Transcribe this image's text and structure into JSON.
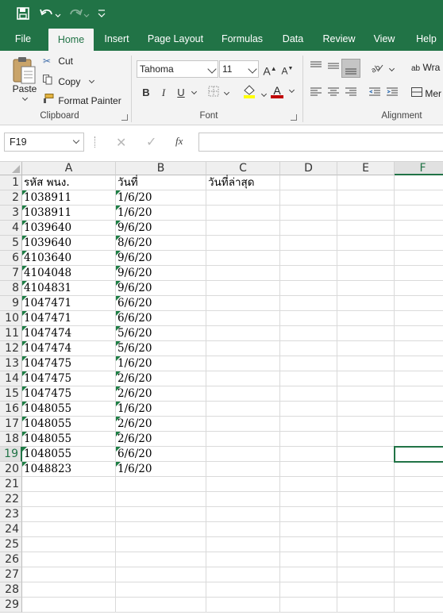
{
  "ribbon_tabs": [
    "File",
    "Home",
    "Insert",
    "Page Layout",
    "Formulas",
    "Data",
    "Review",
    "View",
    "Help"
  ],
  "active_tab": "Home",
  "clipboard": {
    "paste_label": "Paste",
    "cut_label": "Cut",
    "copy_label": "Copy",
    "format_painter_label": "Format Painter",
    "group_label": "Clipboard"
  },
  "font": {
    "family": "Tahoma",
    "size": "11",
    "grow_label": "A",
    "shrink_label": "A",
    "bold": "B",
    "italic": "I",
    "underline": "U",
    "font_color_label": "A",
    "group_label": "Font",
    "fill_color": "#FFFF00",
    "font_color": "#C00000"
  },
  "alignment": {
    "wrap_label": "Wra",
    "merge_label": "Mer",
    "group_label": "Alignment"
  },
  "formula_bar": {
    "name_box": "F19",
    "fx_label": "fx",
    "formula_value": ""
  },
  "columns": [
    "A",
    "B",
    "C",
    "D",
    "E",
    "F"
  ],
  "selected_column": "F",
  "selected_row": 19,
  "row_numbers": [
    1,
    2,
    3,
    4,
    5,
    6,
    7,
    8,
    9,
    10,
    11,
    12,
    13,
    14,
    15,
    16,
    17,
    18,
    19,
    20,
    21,
    22,
    23,
    24,
    25,
    26,
    27,
    28,
    29
  ],
  "headers": {
    "A": "รหัส พนง.",
    "B": "วันที่",
    "C": "วันที่ล่าสุด"
  },
  "rows": [
    {
      "A": "1038911",
      "B": "1/6/20"
    },
    {
      "A": "1038911",
      "B": "1/6/20"
    },
    {
      "A": "1039640",
      "B": "9/6/20"
    },
    {
      "A": "1039640",
      "B": "8/6/20"
    },
    {
      "A": "4103640",
      "B": "9/6/20"
    },
    {
      "A": "4104048",
      "B": "9/6/20"
    },
    {
      "A": "4104831",
      "B": "9/6/20"
    },
    {
      "A": "1047471",
      "B": "6/6/20"
    },
    {
      "A": "1047471",
      "B": "6/6/20"
    },
    {
      "A": "1047474",
      "B": "5/6/20"
    },
    {
      "A": "1047474",
      "B": "5/6/20"
    },
    {
      "A": "1047475",
      "B": "1/6/20"
    },
    {
      "A": "1047475",
      "B": "2/6/20"
    },
    {
      "A": "1047475",
      "B": "2/6/20"
    },
    {
      "A": "1048055",
      "B": "1/6/20"
    },
    {
      "A": "1048055",
      "B": "2/6/20"
    },
    {
      "A": "1048055",
      "B": "2/6/20"
    },
    {
      "A": "1048055",
      "B": "6/6/20"
    },
    {
      "A": "1048823",
      "B": "1/6/20"
    }
  ],
  "colors": {
    "accent": "#217346",
    "error_indicator": "#1E7E45"
  }
}
